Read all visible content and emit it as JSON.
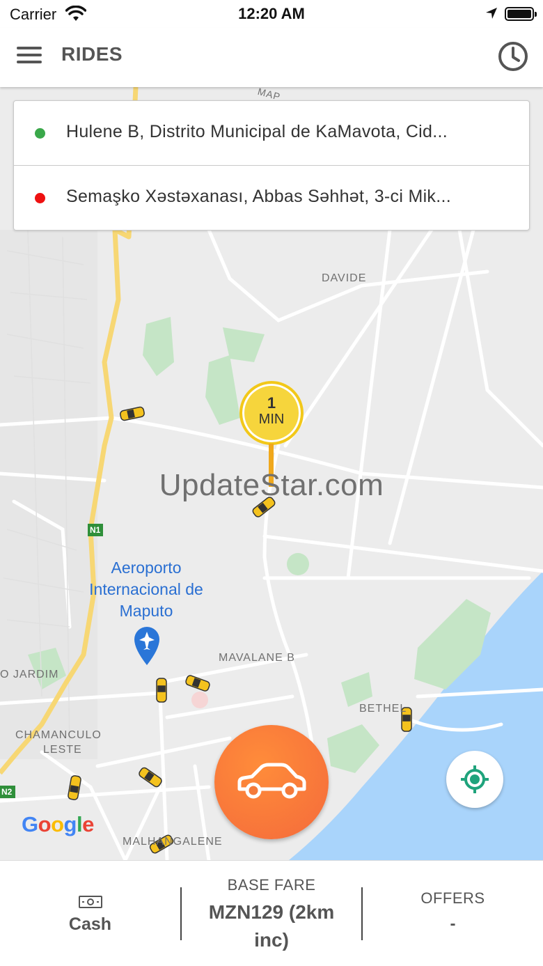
{
  "status_bar": {
    "carrier": "Carrier",
    "time": "12:20 AM"
  },
  "header": {
    "title": "RIDES",
    "menu_icon": "hamburger-menu-icon",
    "history_icon": "clock-history-icon"
  },
  "locations": {
    "pickup": {
      "text": "Hulene B, Distrito Municipal de KaMavota, Cid...",
      "dot_color": "#3aa84a"
    },
    "dropoff": {
      "text": "Semaşko Xəstəxanası, Abbas Səhhət, 3-ci Mik...",
      "dot_color": "#ee1111"
    }
  },
  "map": {
    "eta_value": "1",
    "eta_unit": "MIN",
    "watermark": "UpdateStar.com",
    "airport_label": "Aeroporto Internacional de Maputo",
    "labels": {
      "davide": "DAVIDE",
      "mavalane": "MAVALANE B",
      "jardim": "O JARDIM",
      "chamanculo_1": "CHAMANCULO",
      "chamanculo_2": "LESTE",
      "bethel": "BETHEL",
      "malhangalene": "MALHANGALENE",
      "road_n1": "N1",
      "road_n2": "N2",
      "top_fragment": "MAP"
    },
    "google_logo": "Google",
    "colors": {
      "water": "#a9d4fb",
      "park": "#c5e5c6",
      "major_road": "#f7d774",
      "land": "#ececec"
    }
  },
  "actions": {
    "request_icon": "car-icon",
    "recenter_icon": "crosshair-location-icon"
  },
  "bottom_bar": {
    "payment_label": "Cash",
    "payment_icon": "cash-note-icon",
    "fare_label": "BASE FARE",
    "fare_value": "MZN129 (2km inc)",
    "offers_label": "OFFERS",
    "offers_value": "-"
  },
  "colors": {
    "accent_orange": "#f47a3a",
    "eta_yellow": "#f6d53c",
    "recenter_green": "#1fa37c"
  }
}
